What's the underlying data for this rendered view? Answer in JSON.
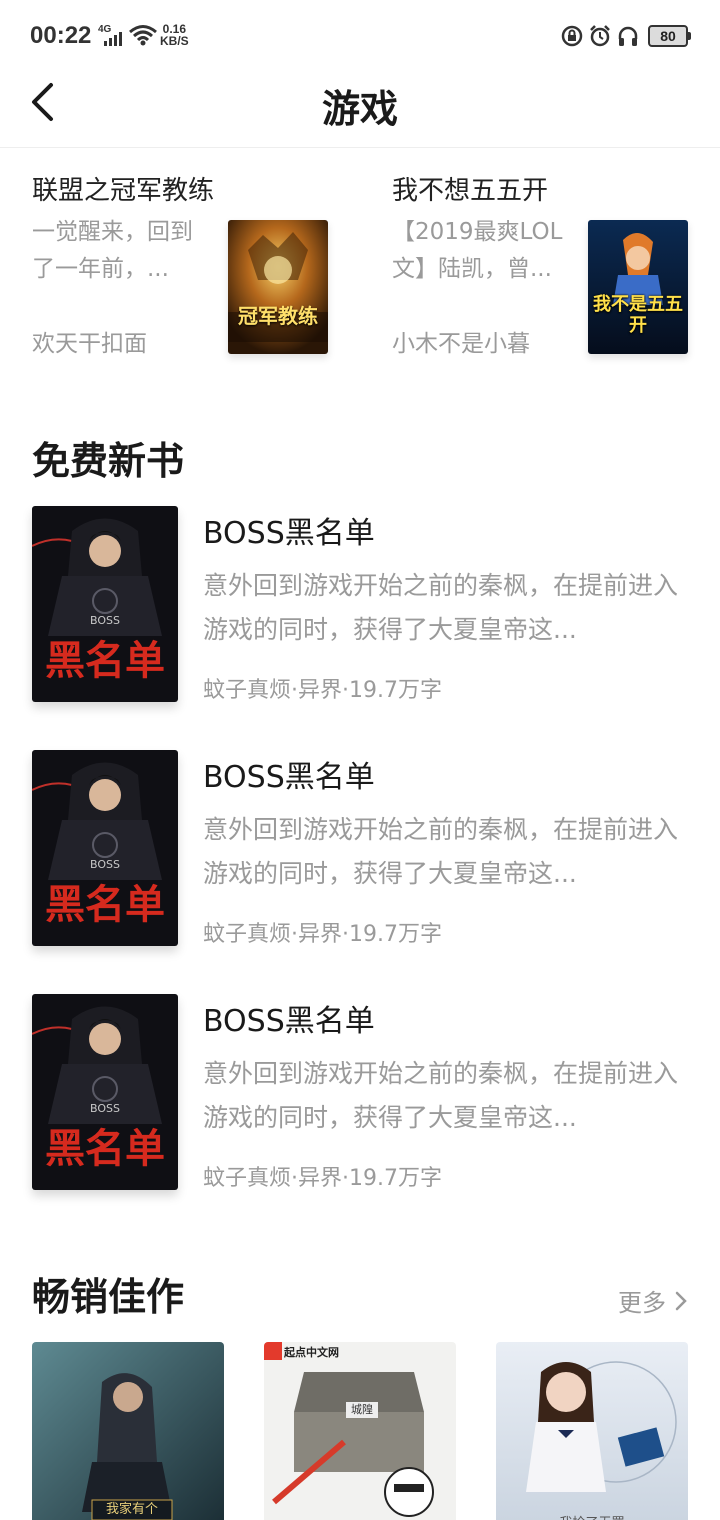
{
  "status_bar": {
    "time": "00:22",
    "network": "4G",
    "speed_value": "0.16",
    "speed_unit": "KB/S",
    "battery": "80"
  },
  "nav": {
    "title": "游戏"
  },
  "featured": [
    {
      "title": "联盟之冠军教练",
      "desc": "一觉醒来，回到了一年前，...",
      "author": "欢天干扣面",
      "cover_text": "冠军教练"
    },
    {
      "title": "我不想五五开",
      "desc": "【2019最爽LOL文】陆凯，曾...",
      "author": "小木不是小暮",
      "cover_text": "我不是五五开"
    }
  ],
  "free_new": {
    "heading": "免费新书",
    "books": [
      {
        "title": "BOSS黑名单",
        "desc": "意外回到游戏开始之前的秦枫，在提前进入游戏的同时，获得了大夏皇帝这...",
        "meta": "蚊子真烦·异界·19.7万字",
        "cover_text": "黑名单",
        "cover_sub": "BOSS"
      },
      {
        "title": "BOSS黑名单",
        "desc": "意外回到游戏开始之前的秦枫，在提前进入游戏的同时，获得了大夏皇帝这...",
        "meta": "蚊子真烦·异界·19.7万字",
        "cover_text": "黑名单",
        "cover_sub": "BOSS"
      },
      {
        "title": "BOSS黑名单",
        "desc": "意外回到游戏开始之前的秦枫，在提前进入游戏的同时，获得了大夏皇帝这...",
        "meta": "蚊子真烦·异界·19.7万字",
        "cover_text": "黑名单",
        "cover_sub": "BOSS"
      }
    ]
  },
  "bestsellers": {
    "heading": "畅销佳作",
    "more_label": "更多",
    "covers": [
      {
        "caption": "我家有个"
      },
      {
        "badge": "起点中文网",
        "caption": "城隍"
      },
      {
        "caption": "我捡了无罪"
      }
    ]
  },
  "colors": {
    "text_primary": "#1a1a1a",
    "text_secondary": "#9a9a9a",
    "cover_red": "#d62a1e"
  }
}
